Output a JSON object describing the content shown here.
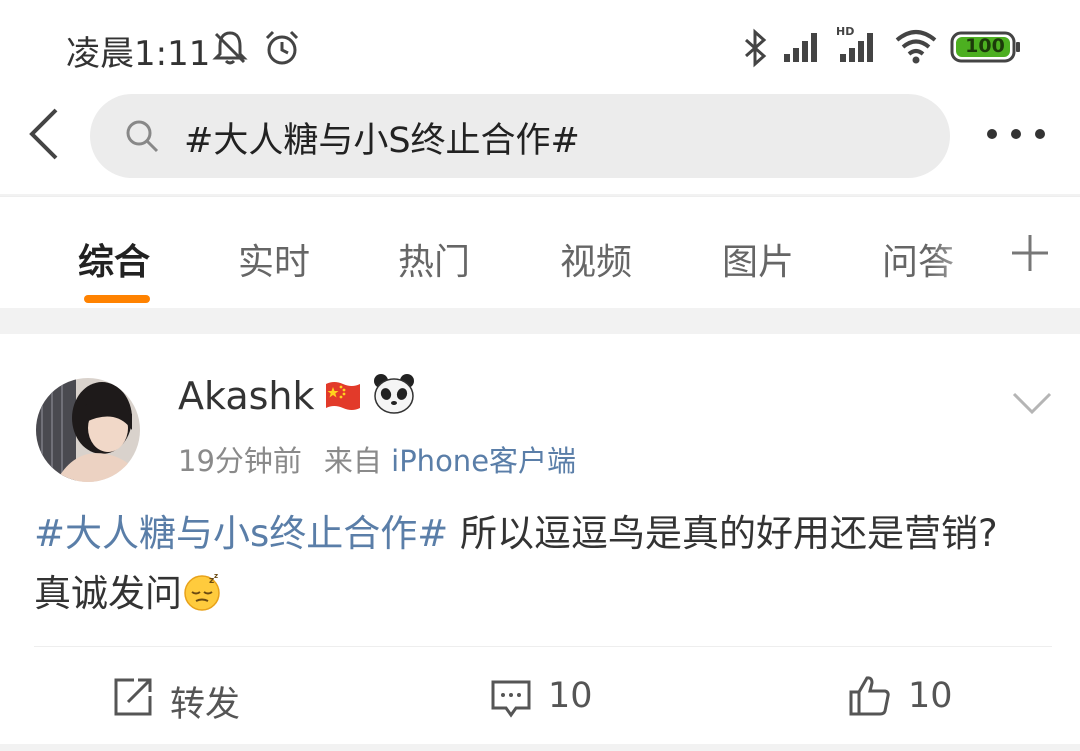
{
  "status_bar": {
    "time": "凌晨1:11",
    "battery": "100",
    "signal_label": "HD",
    "icons": [
      "mute-icon",
      "alarm-icon",
      "bluetooth-icon",
      "signal-icon",
      "hd-signal-icon",
      "wifi-icon",
      "battery-icon"
    ],
    "battery_color": "#4caf20"
  },
  "search": {
    "query": "#大人糖与小S终止合作#"
  },
  "tabs": [
    {
      "label": "综合",
      "active": true
    },
    {
      "label": "实时"
    },
    {
      "label": "热门"
    },
    {
      "label": "视频"
    },
    {
      "label": "图片"
    },
    {
      "label": "问答"
    }
  ],
  "accent_color": "#ff8200",
  "post": {
    "username": "Akashk",
    "time": "19分钟前",
    "source_prefix": "来自",
    "source": "iPhone客户端",
    "topic": "#大人糖与小s终止合作#",
    "text": " 所以逗逗鸟是真的好用还是营销? 真诚发问",
    "link_color": "#5a7ea8"
  },
  "actions": {
    "repost_label": "转发",
    "comment_count": "10",
    "like_count": "10"
  }
}
